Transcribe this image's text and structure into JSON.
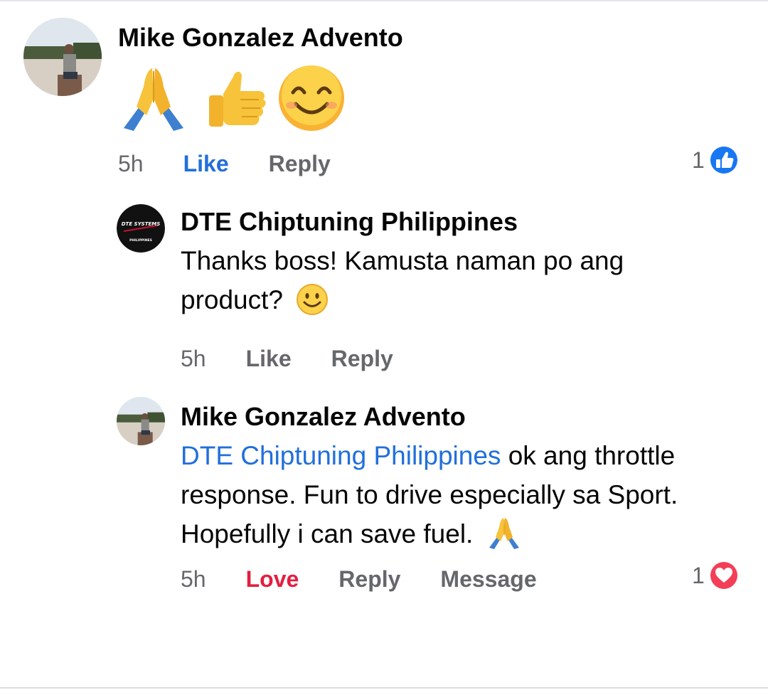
{
  "comments": [
    {
      "author": "Mike Gonzalez Advento",
      "emoji_row": [
        "folded-hands",
        "thumbs-up",
        "smiling-face"
      ],
      "time": "5h",
      "like_label": "Like",
      "reply_label": "Reply",
      "reaction": {
        "type": "like",
        "count": "1"
      }
    },
    {
      "author": "DTE Chiptuning Philippines",
      "avatar_text": {
        "line1": "DTE SYSTEMS",
        "line2": "PHILIPPINES"
      },
      "text_line1": "Thanks boss! Kamusta naman po ang",
      "text_line2": "product?",
      "trailing_emoji": "slightly-smiling-face",
      "time": "5h",
      "like_label": "Like",
      "reply_label": "Reply"
    },
    {
      "author": "Mike Gonzalez Advento",
      "mention": "DTE Chiptuning Philippines",
      "text_line1_rest": " ok ang throttle",
      "text_line2": "response. Fun to drive especially sa Sport.",
      "text_line3": "Hopefully i can save fuel.",
      "trailing_emoji": "folded-hands",
      "time": "5h",
      "love_label": "Love",
      "reply_label": "Reply",
      "message_label": "Message",
      "reaction": {
        "type": "love",
        "count": "1"
      }
    }
  ],
  "colors": {
    "link_blue": "#216fdb",
    "love_red": "#e41e3f",
    "meta_gray": "#65676b",
    "like_badge": "#1877f2"
  }
}
